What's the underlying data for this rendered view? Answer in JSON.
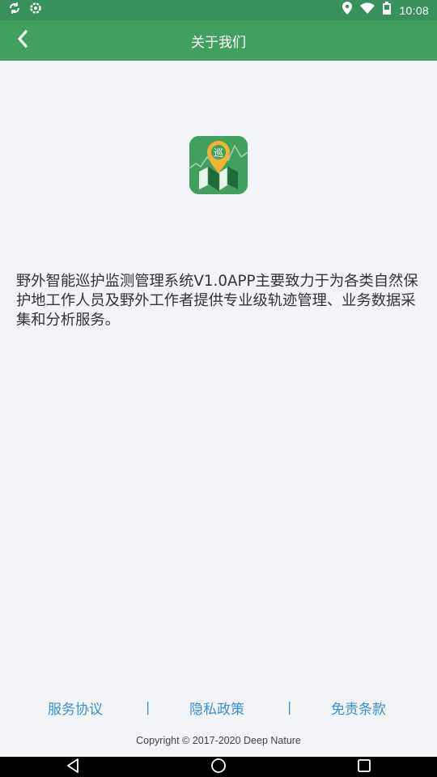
{
  "status_bar": {
    "time": "10:08",
    "left_icons": [
      "sync-icon",
      "settings-icon"
    ],
    "right_icons": [
      "location-icon",
      "wifi-icon",
      "battery-icon"
    ]
  },
  "app_bar": {
    "title": "关于我们",
    "back_icon": "chevron-left-icon",
    "background": "#41a05d"
  },
  "logo": {
    "glyph": "巡",
    "icon": "map-pin-logo-icon"
  },
  "description": "野外智能巡护监测管理系统V1.0APP主要致力于为各类自然保护地工作人员及野外工作者提供专业级轨迹管理、业务数据采集和分析服务。",
  "footer": {
    "links": [
      "服务协议",
      "隐私政策",
      "免责条款"
    ],
    "separator": "|",
    "copyright": "Copyright © 2017-2020 Deep Nature",
    "link_color": "#3a8fd6"
  },
  "nav_bar": {
    "buttons": [
      "back-triangle-icon",
      "home-circle-icon",
      "recents-square-icon"
    ]
  }
}
